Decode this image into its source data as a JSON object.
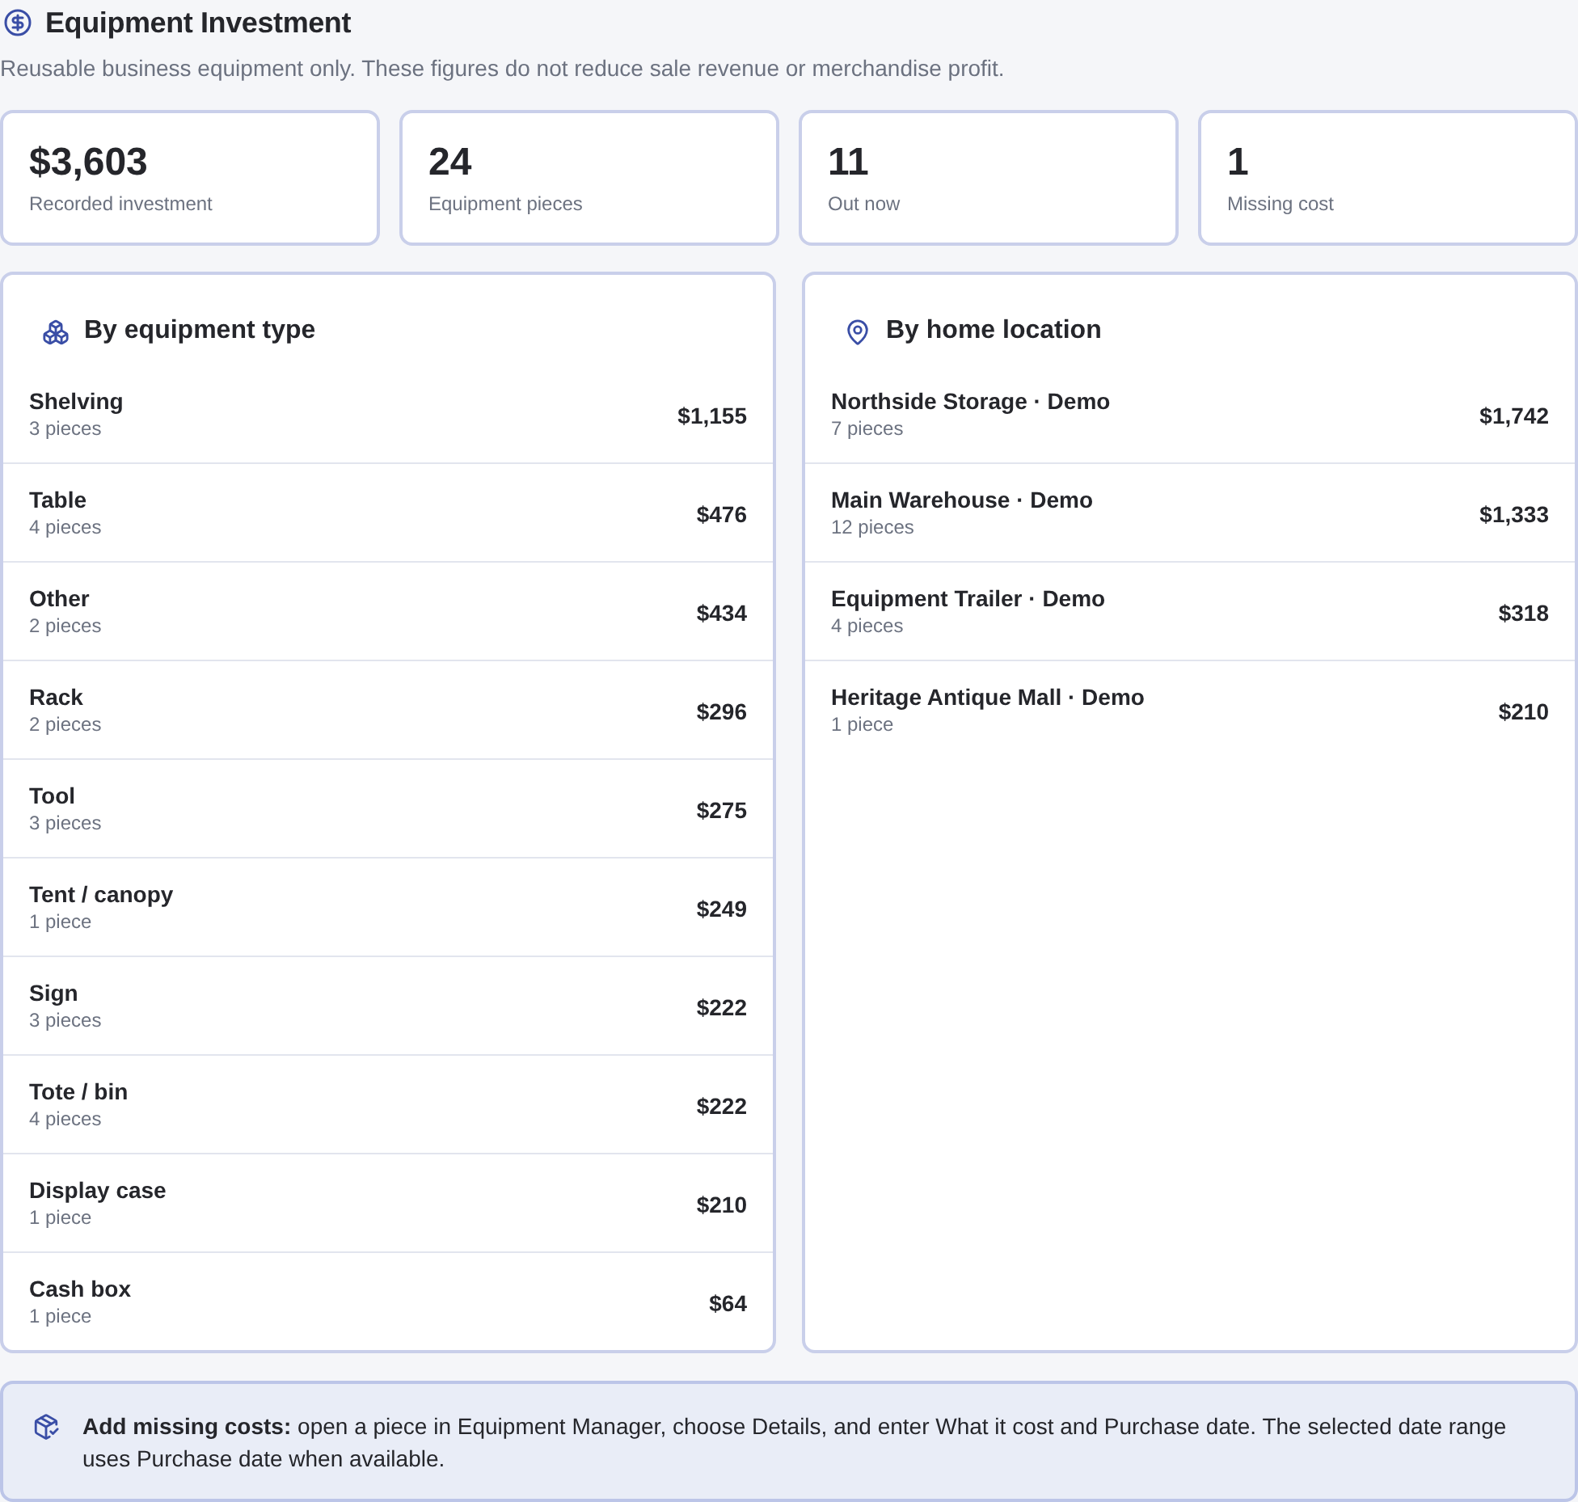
{
  "header": {
    "title": "Equipment Investment",
    "subtitle": "Reusable business equipment only. These figures do not reduce sale revenue or merchandise profit."
  },
  "stats": [
    {
      "value": "$3,603",
      "label": "Recorded investment"
    },
    {
      "value": "24",
      "label": "Equipment pieces"
    },
    {
      "value": "11",
      "label": "Out now"
    },
    {
      "value": "1",
      "label": "Missing cost"
    }
  ],
  "panels": [
    {
      "kind": "type",
      "title": "By equipment type",
      "rows": [
        {
          "name": "Shelving",
          "count": "3 pieces",
          "amount": "$1,155"
        },
        {
          "name": "Table",
          "count": "4 pieces",
          "amount": "$476"
        },
        {
          "name": "Other",
          "count": "2 pieces",
          "amount": "$434"
        },
        {
          "name": "Rack",
          "count": "2 pieces",
          "amount": "$296"
        },
        {
          "name": "Tool",
          "count": "3 pieces",
          "amount": "$275"
        },
        {
          "name": "Tent / canopy",
          "count": "1 piece",
          "amount": "$249"
        },
        {
          "name": "Sign",
          "count": "3 pieces",
          "amount": "$222"
        },
        {
          "name": "Tote / bin",
          "count": "4 pieces",
          "amount": "$222"
        },
        {
          "name": "Display case",
          "count": "1 piece",
          "amount": "$210"
        },
        {
          "name": "Cash box",
          "count": "1 piece",
          "amount": "$64"
        }
      ]
    },
    {
      "kind": "location",
      "title": "By home location",
      "rows": [
        {
          "name": "Northside Storage · Demo",
          "count": "7 pieces",
          "amount": "$1,742"
        },
        {
          "name": "Main Warehouse · Demo",
          "count": "12 pieces",
          "amount": "$1,333"
        },
        {
          "name": "Equipment Trailer · Demo",
          "count": "4 pieces",
          "amount": "$318"
        },
        {
          "name": "Heritage Antique Mall · Demo",
          "count": "1 piece",
          "amount": "$210"
        }
      ]
    }
  ],
  "notice": {
    "text": "**Add missing costs:** open a piece in Equipment Manager, choose Details, and enter What it cost and Purchase date. The selected date range uses Purchase date when available."
  }
}
